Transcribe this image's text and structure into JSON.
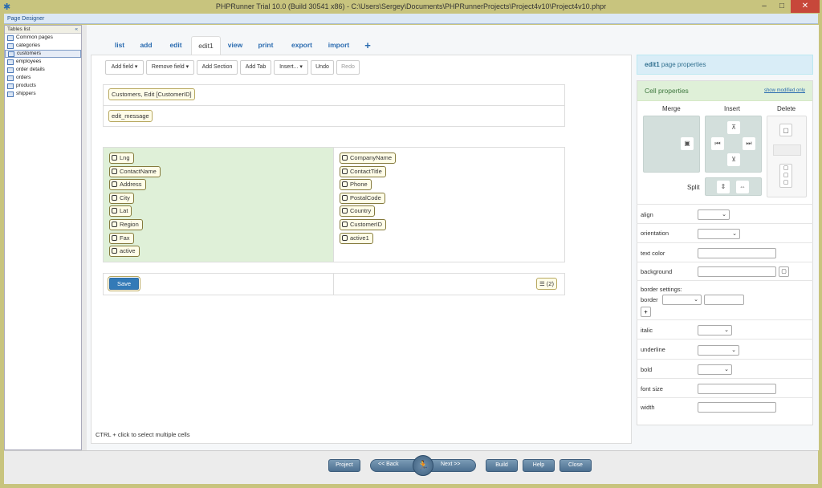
{
  "window": {
    "title": "PHPRunner Trial 10.0 (Build 30541 x86) - C:\\Users\\Sergey\\Documents\\PHPRunnerProjects\\Project4v10\\Project4v10.phpr",
    "section": "Page Designer"
  },
  "tables": {
    "header": "Tables list",
    "collapse": "«",
    "items": [
      "Common pages",
      "categories",
      "customers",
      "employees",
      "order details",
      "orders",
      "products",
      "shippers"
    ],
    "selected": "customers"
  },
  "tabs": [
    "list",
    "add",
    "edit",
    "edit1",
    "view",
    "print",
    "export",
    "import",
    "+"
  ],
  "active_tab": "edit1",
  "toolbar": {
    "add_field": "Add field ▾",
    "remove_field": "Remove field ▾",
    "add_section": "Add Section",
    "add_tab": "Add Tab",
    "insert": "Insert... ▾",
    "undo": "Undo",
    "redo": "Redo"
  },
  "page": {
    "header": "Customers, Edit [CustomerID]",
    "message": "edit_message",
    "left_fields": [
      "Lng",
      "ContactName",
      "Address",
      "City",
      "Lat",
      "Region",
      "Fax",
      "active"
    ],
    "right_fields": [
      "CompanyName",
      "ContactTitle",
      "Phone",
      "PostalCode",
      "Country",
      "CustomerID",
      "active1"
    ],
    "save": "Save",
    "more": "☰ (2)"
  },
  "hint": "CTRL + click to select multiple cells",
  "props": {
    "title_bold": "edit1",
    "title_rest": " page properties",
    "cell_title": "Cell properties",
    "show_modified": "show modified only",
    "merge": "Merge",
    "insert": "Insert",
    "delete": "Delete",
    "split": "Split",
    "align": "align",
    "orientation": "orientation",
    "text_color": "text color",
    "background": "background",
    "border_settings": "border settings:",
    "border": "border",
    "add": "+",
    "italic": "italic",
    "underline": "underline",
    "bold": "bold",
    "font_size": "font size",
    "width": "width"
  },
  "bottom": {
    "project": "Project",
    "back": "<< Back",
    "next": "Next >>",
    "build": "Build",
    "help": "Help",
    "close": "Close"
  },
  "colors": {
    "titlebar": "#c8c47e",
    "accent": "#2a6bb0",
    "field_section": "#dff0d8",
    "nav_button": "#5a7c9b"
  }
}
